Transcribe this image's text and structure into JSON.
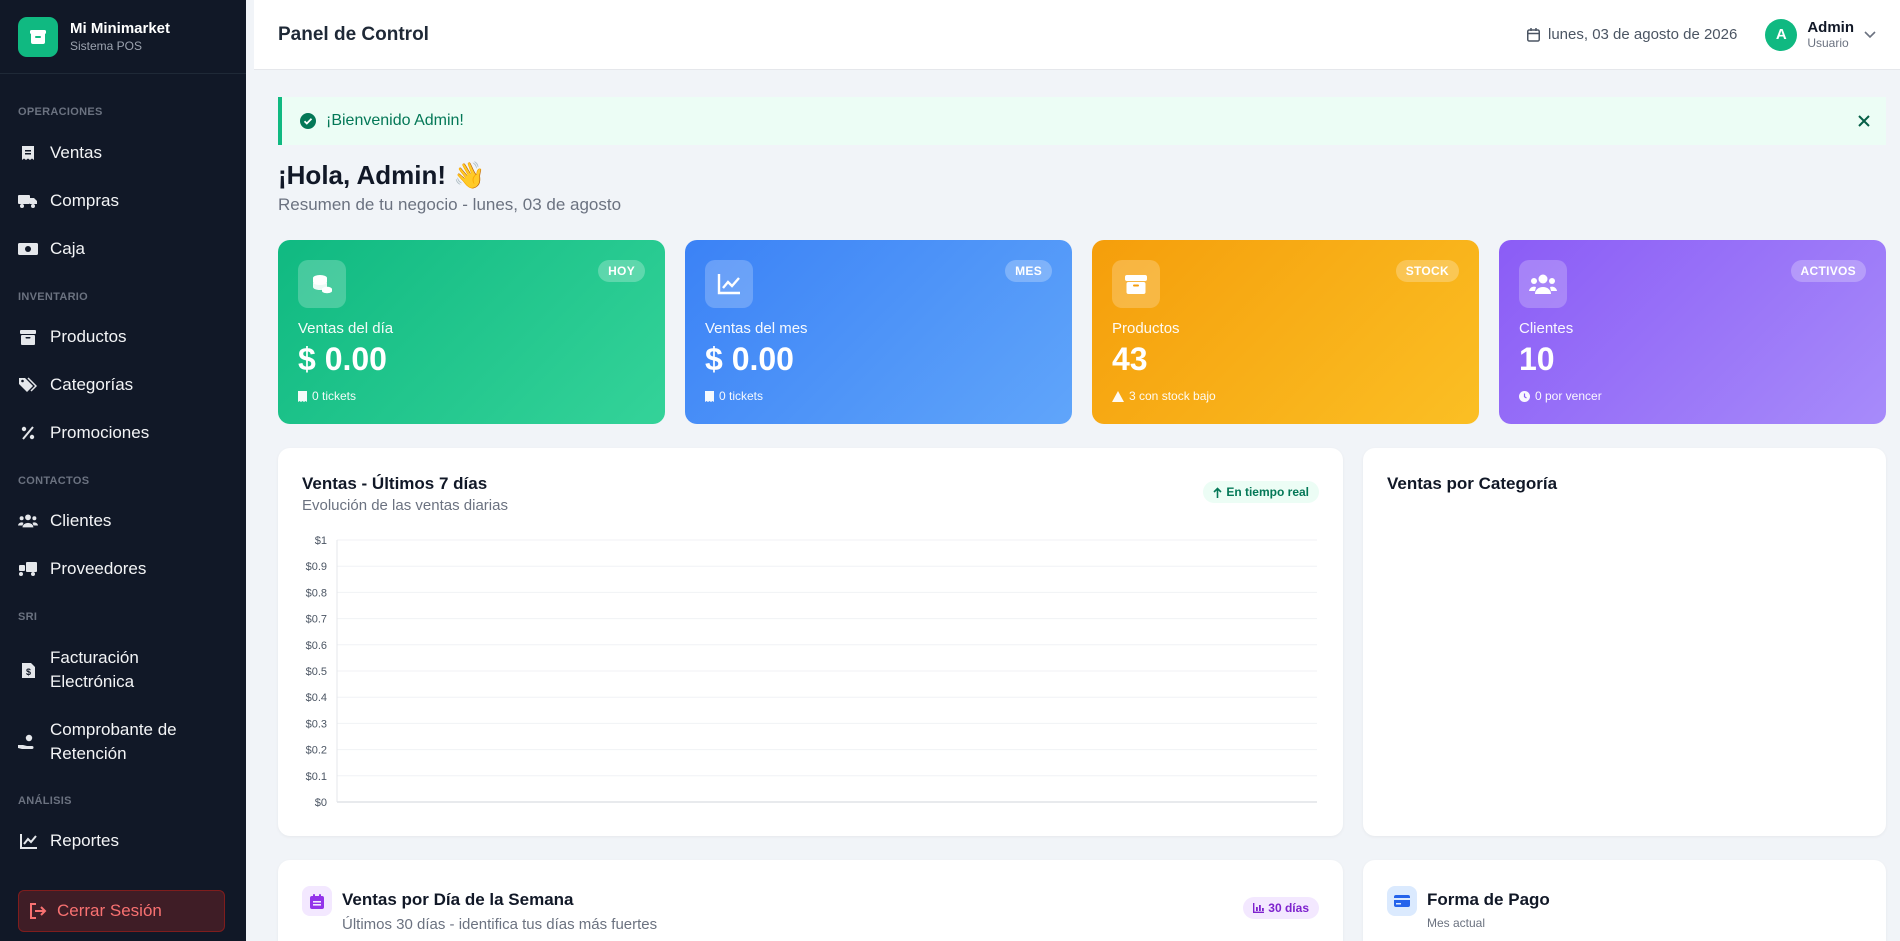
{
  "sidebar": {
    "brand_name": "Mi Minimarket",
    "brand_sub": "Sistema POS",
    "sections": {
      "operaciones": "OPERACIONES",
      "inventario": "INVENTARIO",
      "contactos": "CONTACTOS",
      "sri": "SRI",
      "analisis": "ANÁLISIS"
    },
    "items": {
      "ventas": "Ventas",
      "compras": "Compras",
      "caja": "Caja",
      "productos": "Productos",
      "categorias": "Categorías",
      "promociones": "Promociones",
      "clientes": "Clientes",
      "proveedores": "Proveedores",
      "facturacion_1": "Facturación",
      "facturacion_2": "Electrónica",
      "retencion_1": "Comprobante de",
      "retencion_2": "Retención",
      "reportes": "Reportes"
    },
    "logout": "Cerrar Sesión"
  },
  "header": {
    "title": "Panel de Control",
    "date": "lunes, 03 de agosto de 2026",
    "avatar_letter": "A",
    "user_name": "Admin",
    "user_role": "Usuario"
  },
  "alert": {
    "message": "¡Bienvenido Admin!"
  },
  "greeting": {
    "title": "¡Hola, Admin! 👋",
    "subtitle": "Resumen de tu negocio - lunes, 03 de agosto"
  },
  "stats": [
    {
      "badge": "HOY",
      "label": "Ventas del día",
      "value": "$ 0.00",
      "foot": "0 tickets",
      "color": "#10b981"
    },
    {
      "badge": "MES",
      "label": "Ventas del mes",
      "value": "$ 0.00",
      "foot": "0 tickets",
      "color": "#3b82f6"
    },
    {
      "badge": "STOCK",
      "label": "Productos",
      "value": "43",
      "foot": "3 con stock bajo",
      "color": "#f59e0b"
    },
    {
      "badge": "ACTIVOS",
      "label": "Clientes",
      "value": "10",
      "foot": "0 por vencer",
      "color": "#8b5cf6"
    }
  ],
  "sales_chart": {
    "title": "Ventas - Últimos 7 días",
    "subtitle": "Evolución de las ventas diarias",
    "tag": "En tiempo real"
  },
  "chart_data": {
    "type": "line",
    "title": "Ventas - Últimos 7 días",
    "xlabel": "",
    "ylabel": "",
    "y_ticks": [
      "$0",
      "$0.1",
      "$0.2",
      "$0.3",
      "$0.4",
      "$0.5",
      "$0.6",
      "$0.7",
      "$0.8",
      "$0.9",
      "$1"
    ],
    "ylim": [
      0,
      1
    ],
    "series": [],
    "grid": true
  },
  "category_panel": {
    "title": "Ventas por Categoría"
  },
  "weekday_panel": {
    "title": "Ventas por Día de la Semana",
    "subtitle": "Últimos 30 días - identifica tus días más fuertes",
    "tag": "30 días"
  },
  "payment_panel": {
    "title": "Forma de Pago",
    "subtitle": "Mes actual"
  }
}
